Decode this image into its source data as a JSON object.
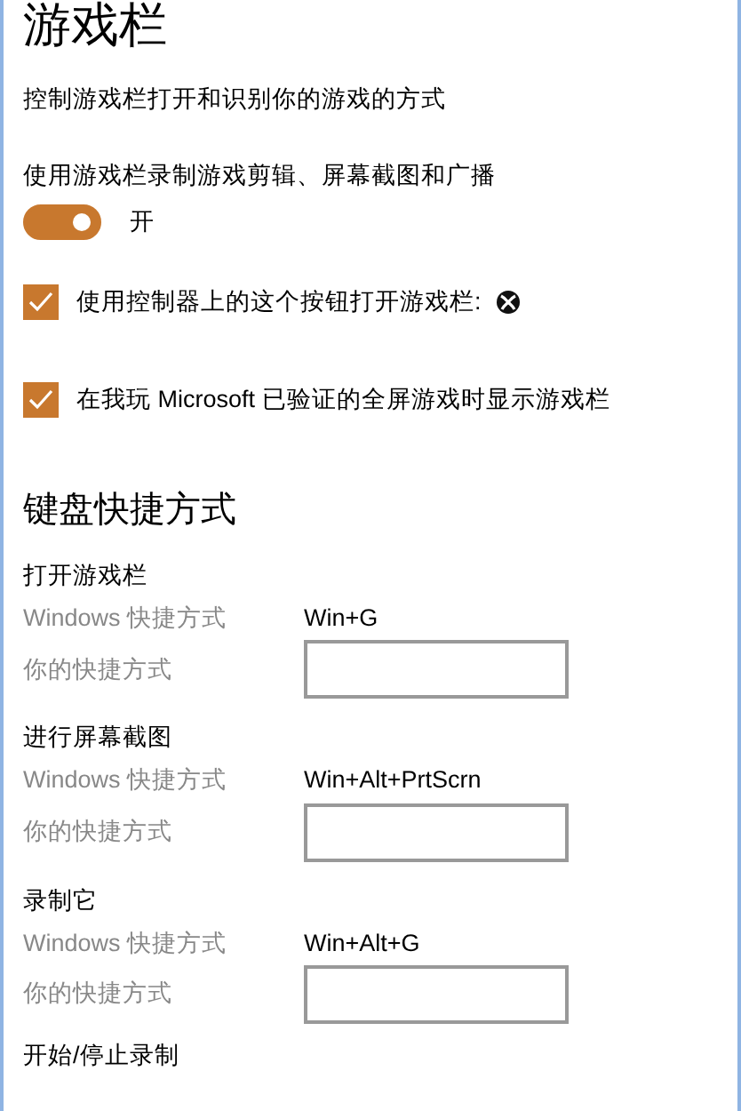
{
  "title": "游戏栏",
  "description": "控制游戏栏打开和识别你的游戏的方式",
  "record_setting": {
    "label": "使用游戏栏录制游戏剪辑、屏幕截图和广播",
    "on": true,
    "state_text": "开"
  },
  "checkboxes": [
    {
      "label": "使用控制器上的这个按钮打开游戏栏:",
      "checked": true,
      "kind": "with-icon"
    },
    {
      "label": "在我玩 Microsoft 已验证的全屏游戏时显示游戏栏",
      "checked": true,
      "kind": "plain"
    }
  ],
  "shortcuts_heading": "键盘快捷方式",
  "shortcuts": [
    {
      "name": "打开游戏栏",
      "windows_label": "Windows 快捷方式",
      "windows_value": "Win+G",
      "custom_label": "你的快捷方式"
    },
    {
      "name": "进行屏幕截图",
      "windows_label": "Windows 快捷方式",
      "windows_value": "Win+Alt+PrtScrn",
      "custom_label": "你的快捷方式"
    },
    {
      "name": "录制它",
      "windows_label": "Windows 快捷方式",
      "windows_value": "Win+Alt+G",
      "custom_label": "你的快捷方式"
    }
  ],
  "next_heading": "开始/停止录制"
}
